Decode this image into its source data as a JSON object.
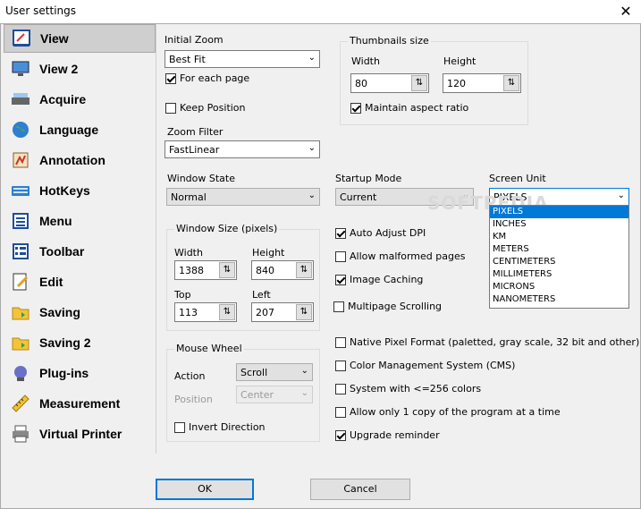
{
  "window": {
    "title": "User settings",
    "close_glyph": "✕"
  },
  "sidebar": {
    "items": [
      {
        "label": "View",
        "icon": "view-icon",
        "active": true
      },
      {
        "label": "View 2",
        "icon": "monitor-icon"
      },
      {
        "label": "Acquire",
        "icon": "scanner-icon"
      },
      {
        "label": "Language",
        "icon": "globe-icon"
      },
      {
        "label": "Annotation",
        "icon": "annotation-icon"
      },
      {
        "label": "HotKeys",
        "icon": "keyboard-icon"
      },
      {
        "label": "Menu",
        "icon": "menu-icon"
      },
      {
        "label": "Toolbar",
        "icon": "toolbar-icon"
      },
      {
        "label": "Edit",
        "icon": "edit-icon"
      },
      {
        "label": "Saving",
        "icon": "saving-icon"
      },
      {
        "label": "Saving 2",
        "icon": "saving2-icon"
      },
      {
        "label": "Plug-ins",
        "icon": "plugin-icon"
      },
      {
        "label": "Measurement",
        "icon": "ruler-icon"
      },
      {
        "label": "Virtual Printer",
        "icon": "printer-icon"
      }
    ]
  },
  "view": {
    "initial_zoom": {
      "label": "Initial Zoom",
      "value": "Best Fit"
    },
    "for_each_page": {
      "label": "For each page",
      "checked": true
    },
    "keep_position": {
      "label": "Keep Position",
      "checked": false
    },
    "zoom_filter": {
      "label": "Zoom Filter",
      "value": "FastLinear"
    },
    "thumbnails": {
      "title": "Thumbnails size",
      "width_label": "Width",
      "width_value": "80",
      "height_label": "Height",
      "height_value": "120",
      "maintain_aspect": {
        "label": "Maintain aspect ratio",
        "checked": true
      }
    },
    "window_state": {
      "label": "Window State",
      "value": "Normal"
    },
    "startup_mode": {
      "label": "Startup Mode",
      "value": "Current"
    },
    "screen_unit": {
      "label": "Screen Unit",
      "value": "PIXELS",
      "options": [
        "PIXELS",
        "INCHES",
        "KM",
        "METERS",
        "CENTIMETERS",
        "MILLIMETERS",
        "MICRONS",
        "NANOMETERS"
      ]
    },
    "window_size": {
      "title": "Window Size (pixels)",
      "width_label": "Width",
      "width_value": "1388",
      "height_label": "Height",
      "height_value": "840",
      "top_label": "Top",
      "top_value": "113",
      "left_label": "Left",
      "left_value": "207"
    },
    "mouse_wheel": {
      "title": "Mouse Wheel",
      "action_label": "Action",
      "action_value": "Scroll",
      "position_label": "Position",
      "position_value": "Center",
      "invert": {
        "label": "Invert Direction",
        "checked": false
      }
    },
    "options": [
      {
        "label": "Auto Adjust DPI",
        "checked": true
      },
      {
        "label": "Allow malformed pages",
        "checked": false
      },
      {
        "label": "Image Caching",
        "checked": true
      },
      {
        "label": "Multipage Scrolling",
        "checked": false
      },
      {
        "label": "Native Pixel Format (paletted, gray scale, 32 bit and other)",
        "checked": false
      },
      {
        "label": "Color Management System (CMS)",
        "checked": false
      },
      {
        "label": "System with <=256 colors",
        "checked": false
      },
      {
        "label": "Allow only 1 copy of the program at a time",
        "checked": false
      },
      {
        "label": "Upgrade reminder",
        "checked": true
      }
    ]
  },
  "footer": {
    "ok_label": "OK",
    "cancel_label": "Cancel"
  },
  "watermark": "SOFTPEDIA",
  "colors": {
    "selection": "#0078d7",
    "active_side": "#cfcfcf"
  }
}
